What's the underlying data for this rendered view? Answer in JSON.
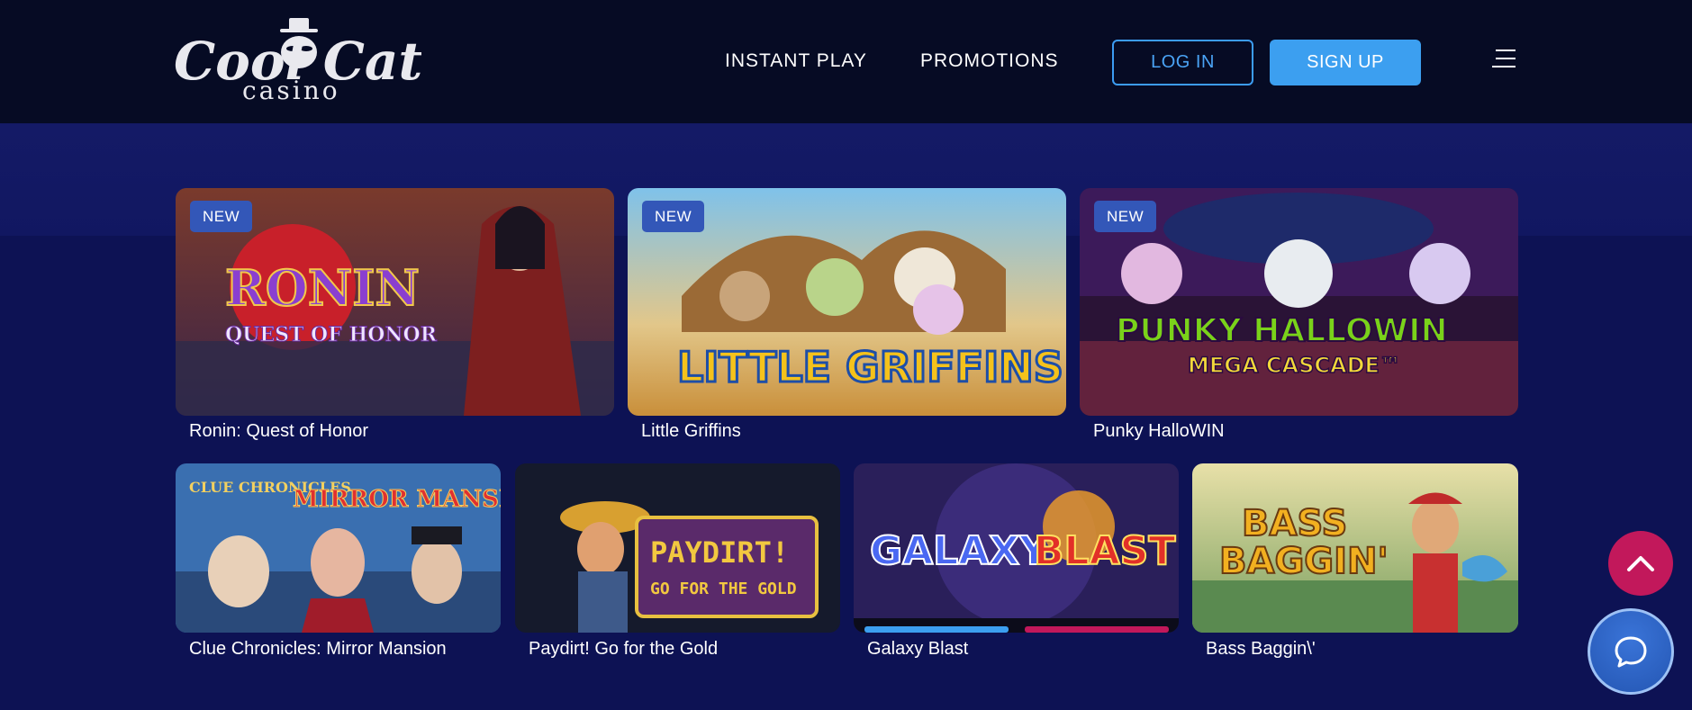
{
  "header": {
    "logo": {
      "primary": "Cool Cat",
      "secondary": "casino"
    },
    "nav": [
      {
        "label": "INSTANT PLAY"
      },
      {
        "label": "PROMOTIONS"
      }
    ],
    "login_label": "LOG IN",
    "signup_label": "SIGN UP",
    "menu_icon": "hamburger-menu-icon"
  },
  "games_row1": [
    {
      "title": "Ronin: Quest of Honor",
      "badge": "NEW",
      "art_text": [
        "RONIN",
        "QUEST OF HONOR"
      ]
    },
    {
      "title": "Little Griffins",
      "badge": "NEW",
      "art_text": [
        "LITTLE GRIFFINS"
      ]
    },
    {
      "title": "Punky HalloWIN",
      "badge": "NEW",
      "art_text": [
        "PUNKY HALLOWIN",
        "MEGA CASCADE™"
      ]
    }
  ],
  "games_row2": [
    {
      "title": "Clue Chronicles: Mirror Mansion",
      "art_text": [
        "CLUE CHRONICLES",
        "MIRROR MANSION"
      ]
    },
    {
      "title": "Paydirt! Go for the Gold",
      "art_text": [
        "PAYDIRT!",
        "GO FOR THE GOLD"
      ]
    },
    {
      "title": "Galaxy Blast",
      "art_text": [
        "GALAXY",
        "BLAST"
      ]
    },
    {
      "title": "Bass Baggin\\'",
      "art_text": [
        "BASS",
        "BAGGIN'"
      ]
    }
  ],
  "floating": {
    "scroll_top_icon": "chevron-up-icon",
    "chat_icon": "chat-bubble-icon"
  },
  "colors": {
    "header_bg": "#060b24",
    "page_bg": "#0d1254",
    "accent_blue": "#3c9ff0",
    "badge_blue": "#3357b8",
    "scroll_top_pink": "#c2185b"
  }
}
